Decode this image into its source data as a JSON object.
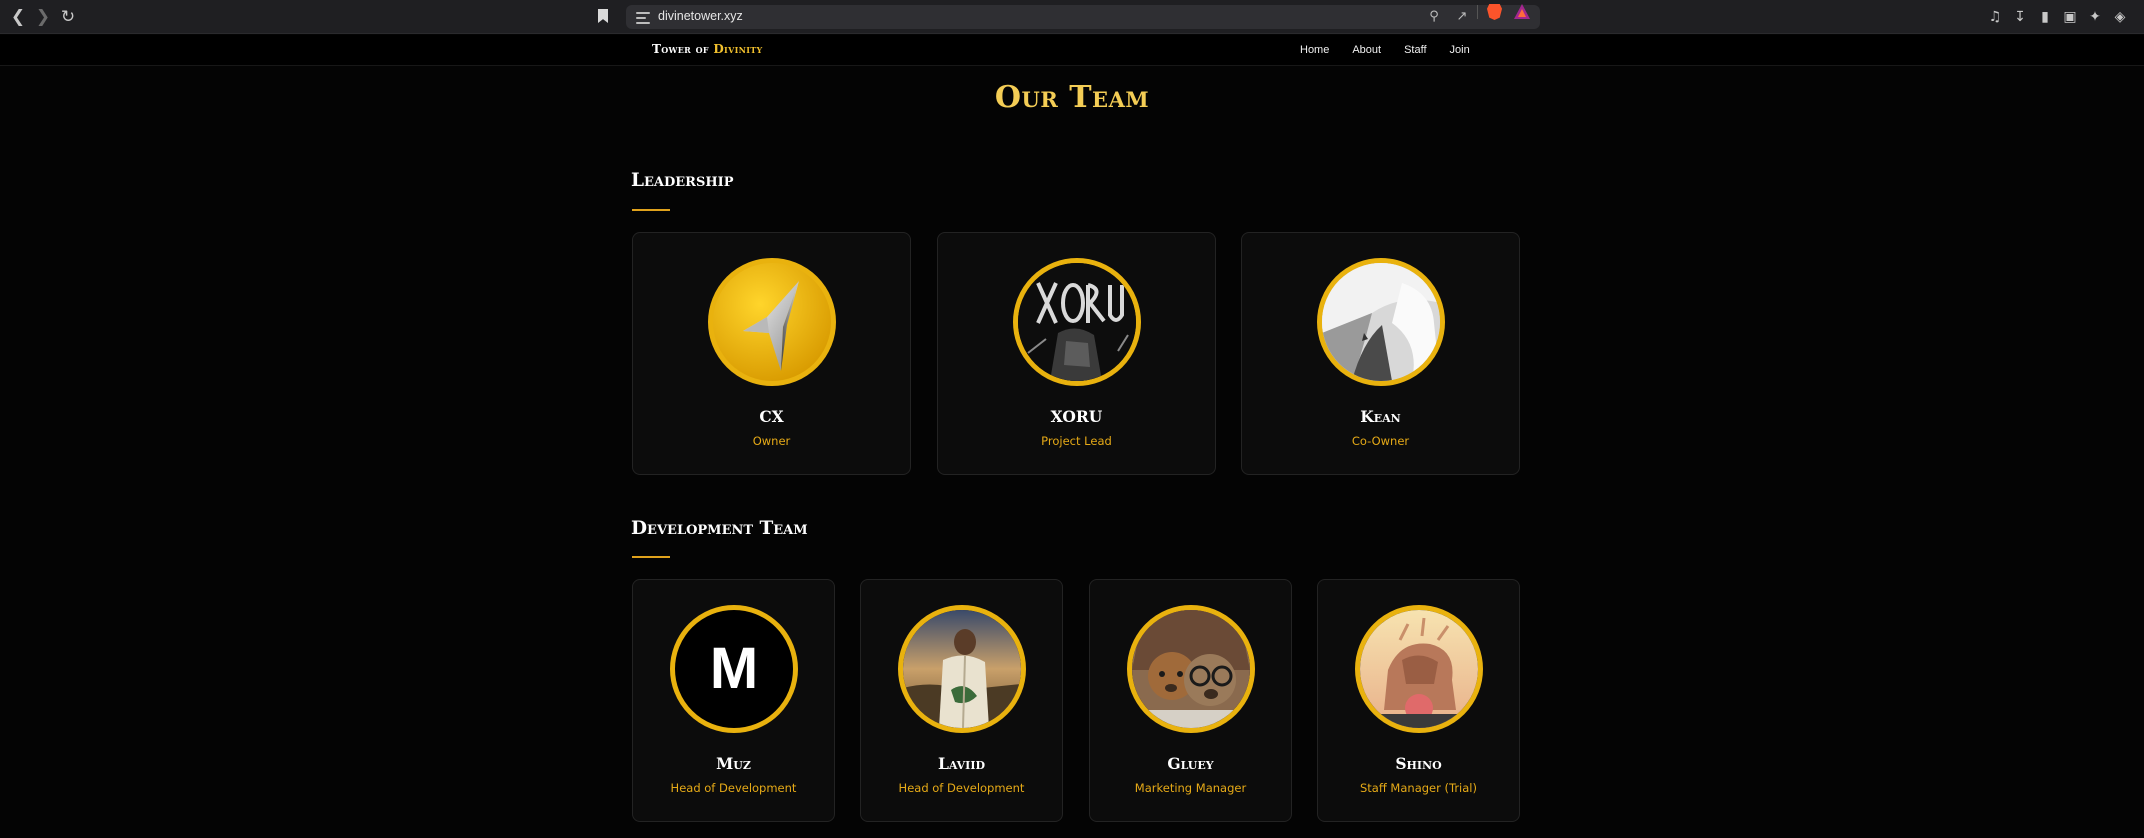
{
  "browser": {
    "url": "divinetower.xyz"
  },
  "site": {
    "brand_main": "Tower of ",
    "brand_accent": "Divinity",
    "nav": [
      "Home",
      "About",
      "Staff",
      "Join"
    ]
  },
  "page": {
    "title": "Our Team"
  },
  "sections": [
    {
      "title": "Leadership",
      "members": [
        {
          "name": "CX",
          "role": "Owner",
          "avatar": "gold-star-icon"
        },
        {
          "name": "XORU",
          "role": "Project Lead",
          "avatar": "xoru-artwork"
        },
        {
          "name": "Kean",
          "role": "Co-Owner",
          "avatar": "grayscale-photo"
        }
      ]
    },
    {
      "title": "Development Team",
      "members": [
        {
          "name": "Muz",
          "role": "Head of Development",
          "avatar": "letter-m",
          "avatar_letter": "M"
        },
        {
          "name": "Laviid",
          "role": "Head of Development",
          "avatar": "painting"
        },
        {
          "name": "Gluey",
          "role": "Marketing Manager",
          "avatar": "teddy-bears"
        },
        {
          "name": "Shino",
          "role": "Staff Manager (Trial)",
          "avatar": "sunset-figure"
        }
      ]
    }
  ],
  "colors": {
    "gold": "#f4cd55",
    "accent": "#e9b20e",
    "role": "#e6aa17",
    "background": "#040404"
  }
}
